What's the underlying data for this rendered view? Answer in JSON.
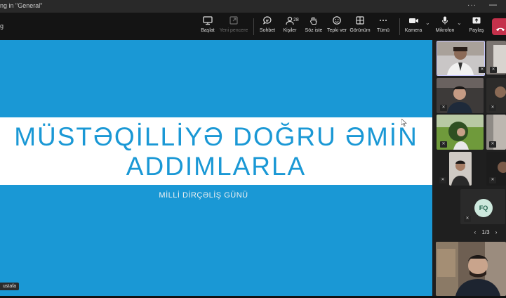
{
  "window": {
    "title": "ng in \"General\"",
    "more": "···",
    "minimize": "—"
  },
  "toolbar": {
    "left_text": "g",
    "start": "Başlat",
    "new_window": "Yeni pencere",
    "chat": "Sohbet",
    "people": "Kişiler",
    "people_count": "28",
    "raise_hand": "Söz iste",
    "react": "Tepki ver",
    "view": "Görünüm",
    "more": "Tümü",
    "camera": "Kamera",
    "mic": "Mikrofon",
    "share": "Paylaş"
  },
  "slide": {
    "headline_line1": "MÜSTƏQİLLİYƏ DOĞRU ƏMİN",
    "headline_line2": "ADDIMLARLA",
    "subtitle": "MİLLİ DİRÇƏLİŞ GÜNÜ"
  },
  "presenter_label": "ustafa",
  "gallery": {
    "avatar_initials": "FQ",
    "page": "1/3",
    "prev": "‹",
    "next": "›"
  },
  "colors": {
    "slide_bg": "#1a98d5",
    "band": "#ffffff",
    "end_call": "#c4314b"
  },
  "icons": [
    "start-icon",
    "new-window-icon",
    "chat-icon",
    "people-icon",
    "hand-icon",
    "emoji-icon",
    "grid-icon",
    "more-icon",
    "camera-icon",
    "mic-icon",
    "share-icon",
    "phone-end-icon",
    "mic-off-icon"
  ]
}
